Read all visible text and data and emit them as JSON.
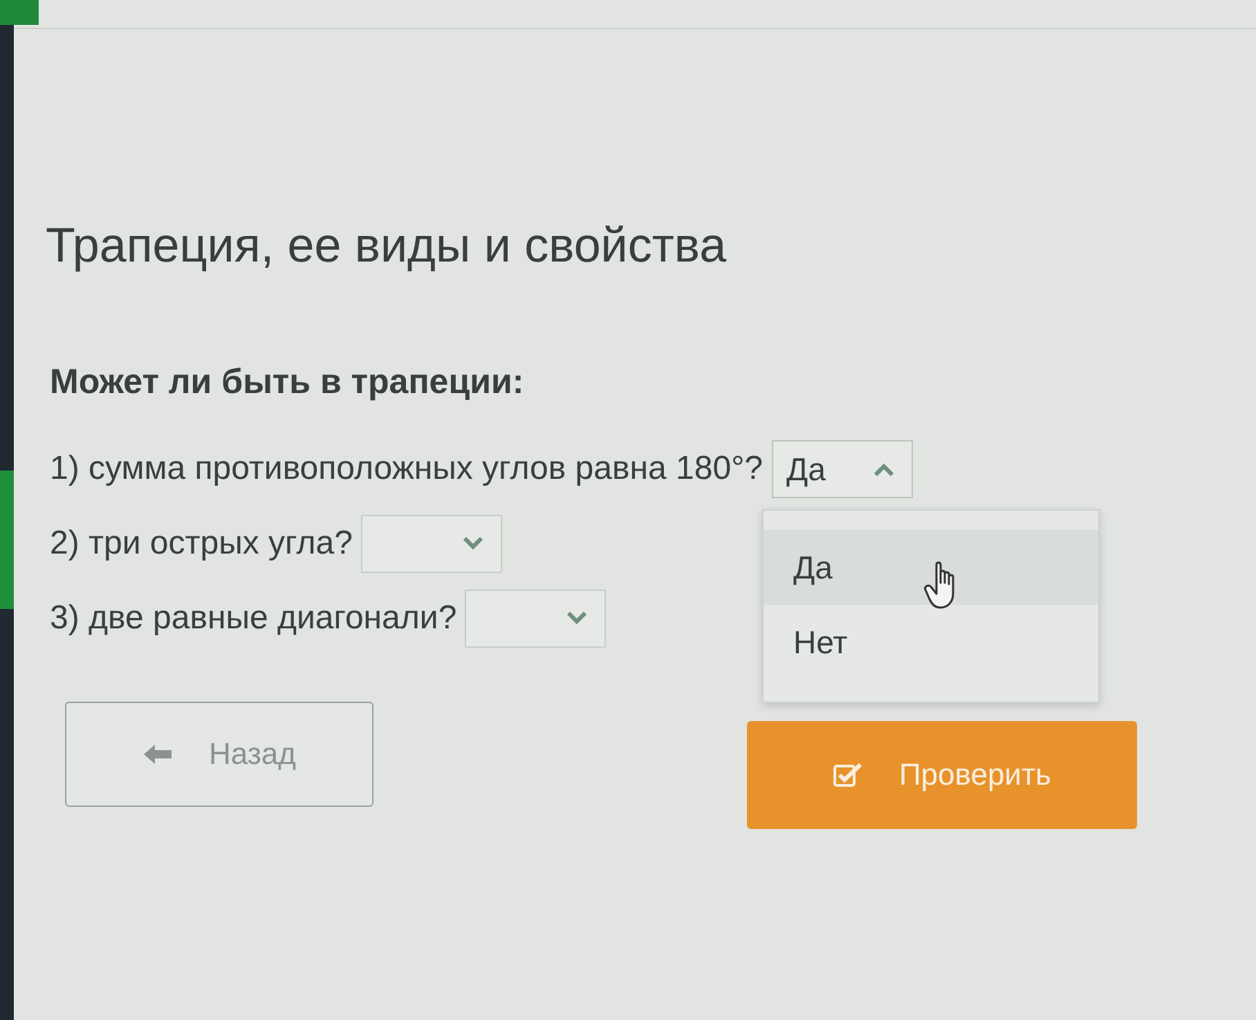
{
  "title": "Трапеция, ее виды и свойства",
  "question": {
    "prompt": "Может ли быть в трапеции:",
    "items": [
      {
        "text": "1) сумма противоположных углов равна 180°?",
        "value": "Да",
        "expanded": true,
        "options": [
          {
            "label": "Да",
            "selected": true
          },
          {
            "label": "Нет",
            "selected": false
          }
        ]
      },
      {
        "text": "2) три острых угла?",
        "expanded": false
      },
      {
        "text": "3) две равные диагонали?",
        "expanded": false
      }
    ]
  },
  "buttons": [
    {
      "label": "Назад",
      "kind": "back"
    },
    {
      "label": "Проверить",
      "kind": "check"
    }
  ]
}
